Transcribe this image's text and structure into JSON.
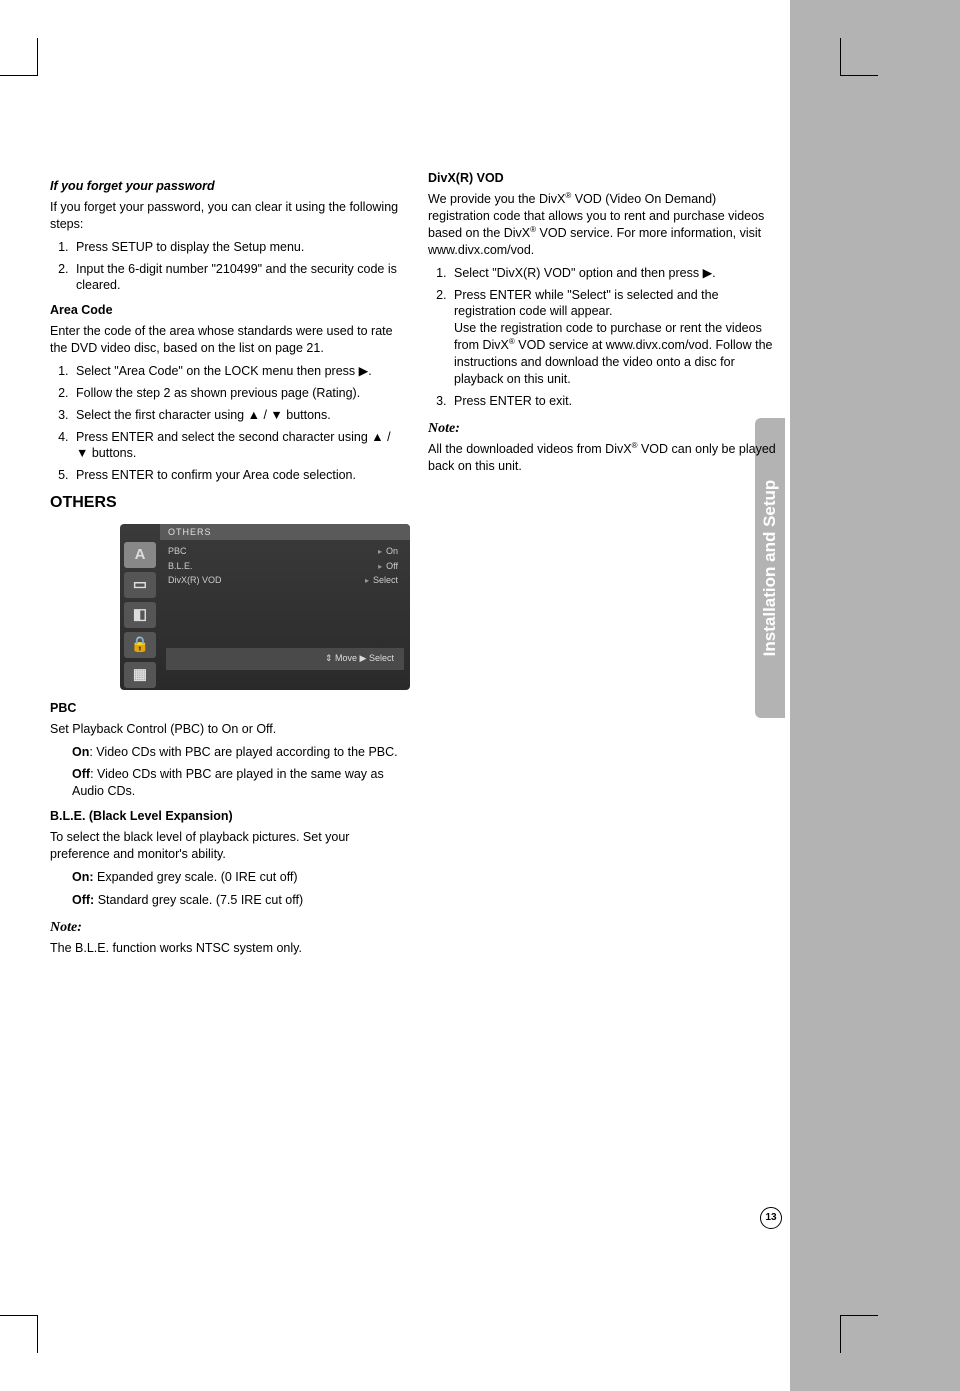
{
  "sectionTab": "Installation and Setup",
  "pageNumber": "13",
  "left": {
    "h_forgot": "If you forget your password",
    "p_forgot": "If you forget your password, you can clear it using the following steps:",
    "forgot_steps": [
      "Press SETUP to display the Setup menu.",
      "Input the 6-digit number \"210499\" and the security code is cleared."
    ],
    "h_area": "Area Code",
    "p_area": "Enter the code of the area whose standards were used to rate the DVD video disc, based on the list on page 21.",
    "area_steps": [
      "Select \"Area Code\" on the LOCK menu then press ▶.",
      "Follow the step 2 as shown previous page (Rating).",
      "Select the first character using ▲ / ▼ buttons.",
      "Press ENTER and select the second character using ▲ / ▼ buttons.",
      "Press ENTER to confirm your Area code selection."
    ],
    "h_others": "OTHERS",
    "h_pbc": "PBC",
    "p_pbc": "Set Playback Control (PBC) to On or Off.",
    "pbc_on_label": "On",
    "pbc_on_text": ": Video CDs with PBC are played according to the PBC.",
    "pbc_off_label": "Off",
    "pbc_off_text": ": Video CDs with PBC are played in the same way as Audio CDs.",
    "h_ble": "B.L.E. (Black Level Expansion)",
    "p_ble": "To select the black level of playback pictures. Set your preference and monitor's ability.",
    "ble_on_label": "On:",
    "ble_on_text": " Expanded grey scale. (0 IRE cut off)",
    "ble_off_label": "Off:",
    "ble_off_text": " Standard grey scale. (7.5 IRE cut off)",
    "note_head": "Note:",
    "note_text": "The B.L.E. function works NTSC system only."
  },
  "right": {
    "h_divx": "DivX(R) VOD",
    "p_divx1a": "We provide you the DivX",
    "p_divx1b": " VOD (Video On Demand) registration code that allows you to rent and purchase videos based on the DivX",
    "p_divx1c": " VOD service. For more information, visit www.divx.com/vod.",
    "divx_steps_1": "Select \"DivX(R) VOD\" option and then press ▶.",
    "divx_steps_2a": "Press ENTER while \"Select\" is selected and the registration code will appear.",
    "divx_steps_2b_pre": "Use the registration code to purchase or rent the videos from DivX",
    "divx_steps_2b_post": " VOD service at www.divx.com/vod. Follow the instructions and download the video onto a disc for playback on this unit.",
    "divx_steps_3": "Press ENTER to exit.",
    "note_head": "Note:",
    "note_text_pre": "All the downloaded videos from DivX",
    "note_text_post": " VOD can only be played back on this unit."
  },
  "fig": {
    "title": "OTHERS",
    "rows": [
      {
        "label": "PBC",
        "value": "On"
      },
      {
        "label": "B.L.E.",
        "value": "Off"
      },
      {
        "label": "DivX(R) VOD",
        "value": "Select"
      }
    ],
    "footer": "⇕ Move ▶ Select",
    "icons": [
      "A",
      "▭",
      "◧",
      "🔒",
      "▦"
    ]
  }
}
